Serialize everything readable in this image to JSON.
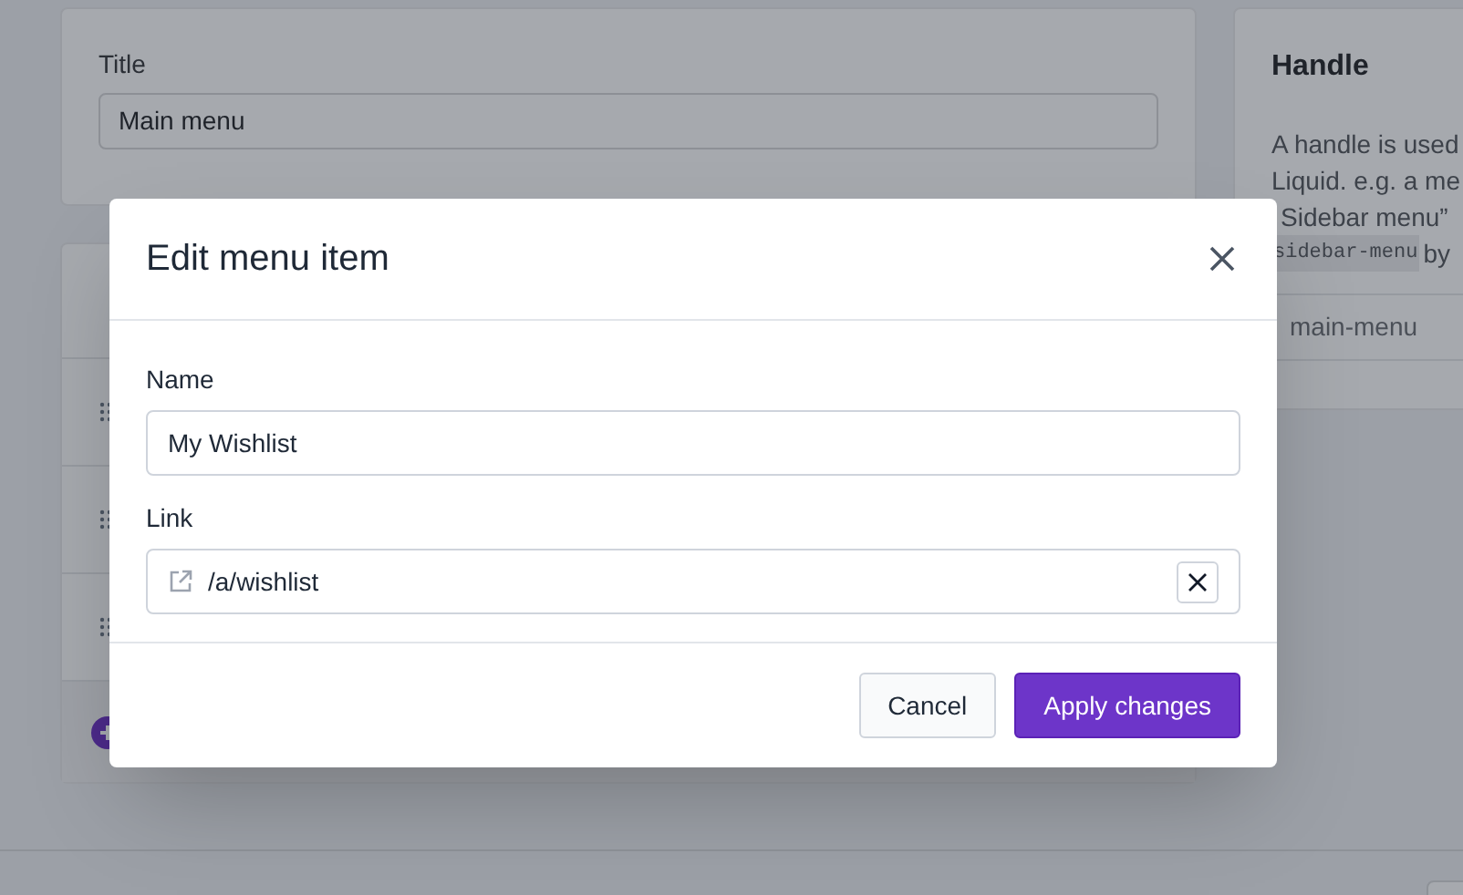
{
  "title_card": {
    "label": "Title",
    "value": "Main menu"
  },
  "handle_card": {
    "heading": "Handle",
    "description": [
      "A handle is used",
      "Liquid. e.g. a me",
      "Sidebar menu”"
    ],
    "code_line": {
      "code": "sidebar-menu",
      "after": "by"
    },
    "value": "main-menu"
  },
  "modal": {
    "title": "Edit menu item",
    "fields": [
      {
        "label": "Name",
        "value": "My Wishlist",
        "kind": "text"
      },
      {
        "label": "Link",
        "value": "/a/wishlist",
        "kind": "link"
      }
    ],
    "buttons": [
      {
        "label": "Cancel",
        "primary": false
      },
      {
        "label": "Apply changes",
        "primary": true
      }
    ]
  }
}
